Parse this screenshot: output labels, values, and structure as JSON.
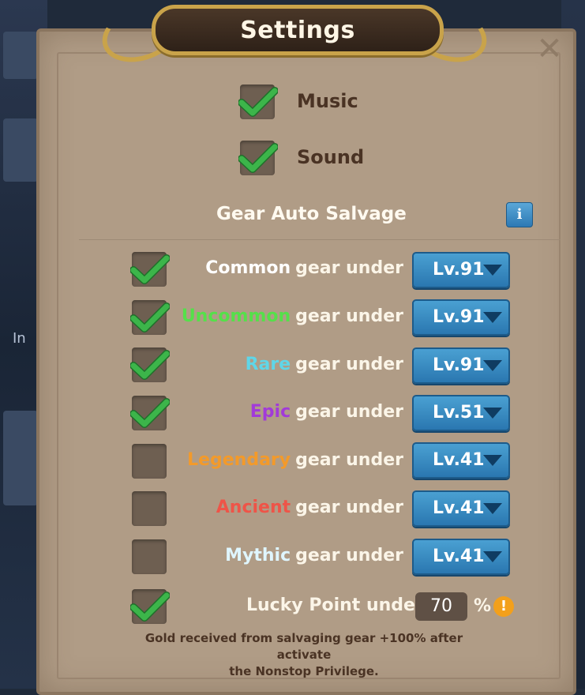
{
  "window": {
    "title": "Settings",
    "close_symbol": "✕"
  },
  "background": {
    "partial_text": "In"
  },
  "toggles": [
    {
      "label": "Music",
      "checked": true
    },
    {
      "label": "Sound",
      "checked": true
    }
  ],
  "auto_salvage": {
    "title": "Gear Auto Salvage",
    "info_icon": "i",
    "rows": [
      {
        "rarity": "Common",
        "rarity_color": "#ffffff",
        "suffix": "gear under",
        "level": "Lv.91",
        "checked": true
      },
      {
        "rarity": "Uncommon",
        "rarity_color": "#55e04a",
        "suffix": "gear under",
        "level": "Lv.91",
        "checked": true
      },
      {
        "rarity": "Rare",
        "rarity_color": "#5fd6e8",
        "suffix": "gear under",
        "level": "Lv.91",
        "checked": true
      },
      {
        "rarity": "Epic",
        "rarity_color": "#a23ad9",
        "suffix": "gear under",
        "level": "Lv.51",
        "checked": true
      },
      {
        "rarity": "Legendary",
        "rarity_color": "#f39a2a",
        "suffix": "gear under",
        "level": "Lv.41",
        "checked": false
      },
      {
        "rarity": "Ancient",
        "rarity_color": "#ee5448",
        "suffix": "gear under",
        "level": "Lv.41",
        "checked": false
      },
      {
        "rarity": "Mythic",
        "rarity_color": "#dff6ff",
        "suffix": "gear under",
        "level": "Lv.41",
        "checked": false
      }
    ]
  },
  "lucky_point": {
    "label": "Lucky Point under",
    "value": "70",
    "unit": "%",
    "warn_icon": "!",
    "checked": true
  },
  "note": {
    "line1": "Gold received from salvaging gear +100% after activate",
    "line2": "the Nonstop Privilege."
  },
  "colors": {
    "check_green": "#3cb54a",
    "panel": "#b09c86",
    "button_blue": "#3a8cc4"
  }
}
